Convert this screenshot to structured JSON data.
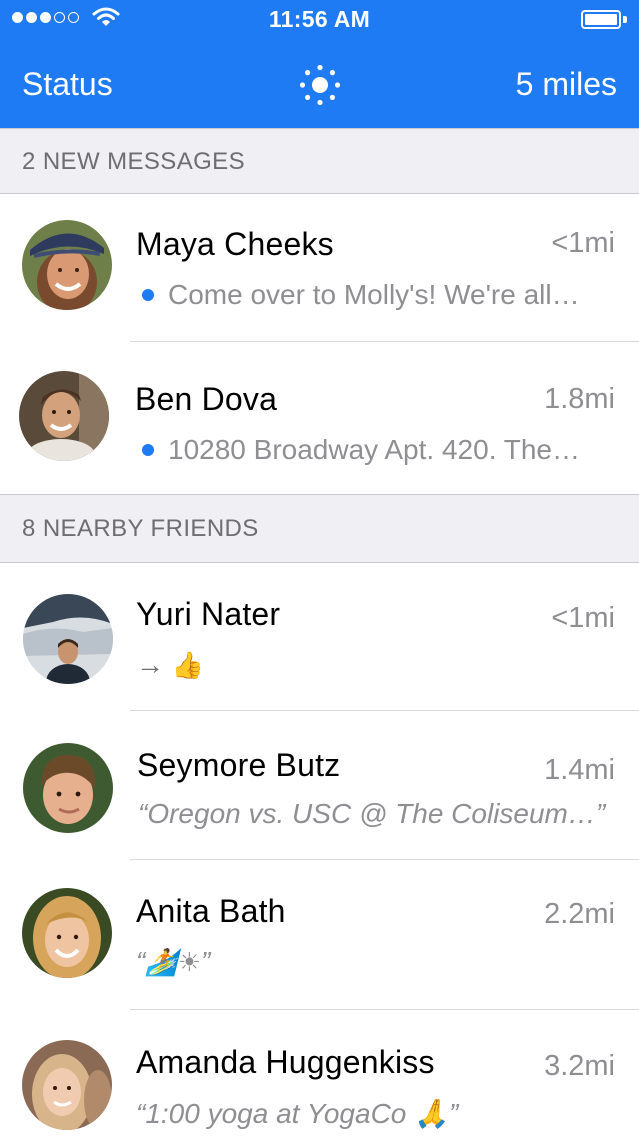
{
  "statusbar": {
    "time": "11:56 AM",
    "signal_full": 3,
    "signal_total": 5
  },
  "navbar": {
    "left_label": "Status",
    "center_icon": "sun-icon",
    "right_label": "5 miles"
  },
  "sections": [
    {
      "label": "2 NEW MESSAGES"
    },
    {
      "label": "8 NEARBY FRIENDS"
    }
  ],
  "messages": [
    {
      "name": "Maya Cheeks",
      "distance": "<1mi",
      "preview": "Come over to Molly's! We're all…",
      "unread": true
    },
    {
      "name": "Ben Dova",
      "distance": "1.8mi",
      "preview": "10280 Broadway Apt. 420. The…",
      "unread": true
    }
  ],
  "friends": [
    {
      "name": "Yuri Nater",
      "distance": "<1mi",
      "preview_arrow": "→",
      "preview_emoji": "👍"
    },
    {
      "name": "Seymore Butz",
      "distance": "1.4mi",
      "preview": "“Oregon vs. USC @ The Coliseum…”"
    },
    {
      "name": "Anita Bath",
      "distance": "2.2mi",
      "preview_open": "“",
      "preview_emoji": "🏄☀",
      "preview_close": "”"
    },
    {
      "name": "Amanda Huggenkiss",
      "distance": "3.2mi",
      "preview": "“1:00 yoga at YogaCo 🙏”"
    }
  ],
  "colors": {
    "accent": "#1f7bf3",
    "section_bg": "#efeff4",
    "secondary_text": "#8e8e93"
  }
}
